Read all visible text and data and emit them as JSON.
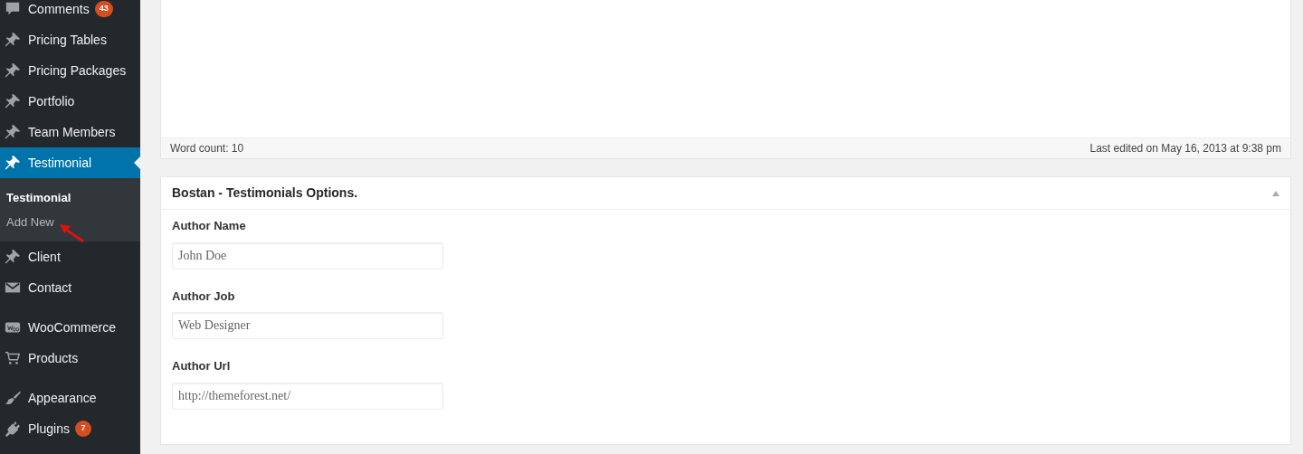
{
  "sidebar": {
    "sections": [
      {
        "items": [
          {
            "label": "Comments",
            "kind": "comment",
            "badge": "43",
            "selected": false
          },
          {
            "label": "Pricing Tables",
            "kind": "pin",
            "selected": false
          },
          {
            "label": "Pricing Packages",
            "kind": "pin",
            "selected": false
          },
          {
            "label": "Portfolio",
            "kind": "pin",
            "selected": false
          },
          {
            "label": "Team Members",
            "kind": "pin",
            "selected": false
          },
          {
            "label": "Testimonial",
            "kind": "pin",
            "selected": true,
            "submenu": [
              {
                "label": "Testimonial",
                "selected": true
              },
              {
                "label": "Add New",
                "selected": false
              }
            ]
          },
          {
            "label": "Client",
            "kind": "pin",
            "selected": false
          },
          {
            "label": "Contact",
            "kind": "mail",
            "selected": false
          }
        ]
      },
      {
        "items": [
          {
            "label": "WooCommerce",
            "kind": "woo",
            "selected": false
          },
          {
            "label": "Products",
            "kind": "cart",
            "selected": false
          }
        ]
      },
      {
        "items": [
          {
            "label": "Appearance",
            "kind": "brush",
            "selected": false
          },
          {
            "label": "Plugins",
            "kind": "plug",
            "badge": "7",
            "selected": false
          }
        ]
      }
    ]
  },
  "editor": {
    "word_count": "Word count: 10",
    "last_edited": "Last edited on May 16, 2013 at 9:38 pm"
  },
  "metabox": {
    "title": "Bostan - Testimonials Options.",
    "fields": [
      {
        "label": "Author Name",
        "value": "John Doe"
      },
      {
        "label": "Author Job",
        "value": "Web Designer"
      },
      {
        "label": "Author Url",
        "value": "http://themeforest.net/"
      }
    ]
  }
}
